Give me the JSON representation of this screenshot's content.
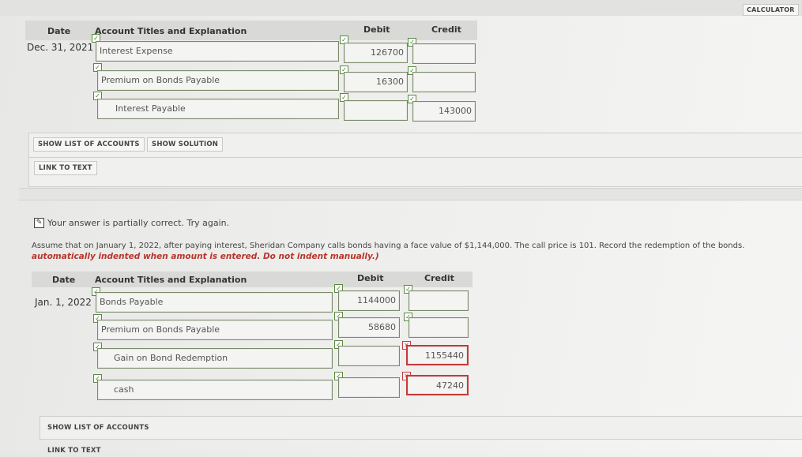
{
  "calculator_label": "CALCULATOR",
  "entry1": {
    "headers": {
      "date": "Date",
      "account": "Account Titles and Explanation",
      "debit": "Debit",
      "credit": "Credit"
    },
    "date": "Dec. 31, 2021",
    "rows": [
      {
        "account": "Interest Expense",
        "debit": "126700",
        "credit": ""
      },
      {
        "account": "Premium on Bonds Payable",
        "debit": "16300",
        "credit": ""
      },
      {
        "account": "Interest Payable",
        "debit": "",
        "credit": "143000"
      }
    ],
    "show_list_label": "SHOW LIST OF ACCOUNTS",
    "show_solution_label": "SHOW SOLUTION",
    "link_label": "LINK TO TEXT"
  },
  "feedback": {
    "status": "Your answer is partially correct.  Try again.",
    "question": "Assume that on January 1, 2022, after paying interest, Sheridan Company calls bonds having a face value of $1,144,000. The call price is 101. Record the redemption of the bonds.",
    "note": "automatically indented when amount is entered. Do not indent manually.)"
  },
  "entry2": {
    "headers": {
      "date": "Date",
      "account": "Account Titles and Explanation",
      "debit": "Debit",
      "credit": "Credit"
    },
    "date": "Jan. 1, 2022",
    "rows": [
      {
        "account": "Bonds Payable",
        "debit": "1144000",
        "credit": ""
      },
      {
        "account": "Premium on Bonds Payable",
        "debit": "58680",
        "credit": ""
      },
      {
        "account": "Gain on Bond Redemption",
        "debit": "",
        "credit": "1155440"
      },
      {
        "account": "cash",
        "debit": "",
        "credit": "47240"
      }
    ],
    "show_list_label": "SHOW LIST OF ACCOUNTS",
    "link_label": "LINK TO TEXT"
  }
}
